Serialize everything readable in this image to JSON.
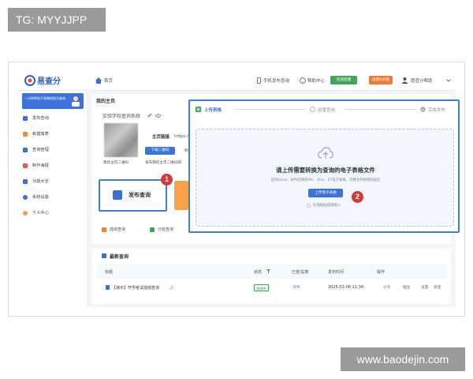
{
  "watermarks": {
    "top": "TG: MYYJJPP",
    "bottom": "www.baodejin.com"
  },
  "topbar": {
    "logo_text": "易查分",
    "logo_sub": "YICHAFEN.COM",
    "home_label": "首页",
    "phone_label": "手机发布查询",
    "help_label": "帮助中心",
    "service_label": "在线客服",
    "upgrade_label": "续费&升级",
    "user_label": "愿查分帮助"
  },
  "sidebar": {
    "banner_text": "一分钟将电子表格转换为查询",
    "items": [
      {
        "label": "发布查询",
        "color": "#3b6fd6"
      },
      {
        "label": "新建填表",
        "color": "#f08a3c"
      },
      {
        "label": "查询管理",
        "color": "#3b6fd6"
      },
      {
        "label": "制作海报",
        "color": "#e05a4e"
      },
      {
        "label": "功能大全",
        "color": "#3b6fd6"
      },
      {
        "label": "系统设置",
        "color": "#3b6fd6"
      },
      {
        "label": "个人中心",
        "color": "#f0a23c"
      }
    ]
  },
  "homepage": {
    "section_title": "我的主页",
    "system_name": "实验学校查询系统",
    "link_label": "主页链接",
    "link_value": "https:/",
    "download_qr": "下载二维码",
    "copy_label": "制",
    "my_qr_caption": "我的主页二维码",
    "publish_qr_caption": "发布我的主页二维码即"
  },
  "actions": {
    "publish_query": "发布查询",
    "step1_badge": "1"
  },
  "quick_links": {
    "score_query": "成绩查询",
    "class_query": "分班查询"
  },
  "latest": {
    "title": "最新查询",
    "columns": [
      "标题",
      "状态",
      "已查/总数",
      "发布时间",
      "操作"
    ],
    "rows": [
      {
        "title": "【演示】开学考试成绩查询",
        "status": "查询中",
        "count": "0/4",
        "time": "2025-02-06 11:34",
        "ops": [
          "分享",
          "推送",
          "设置",
          "管理"
        ]
      }
    ]
  },
  "upload_panel": {
    "steps": [
      "上传表格",
      "设置查询",
      "完成发布"
    ],
    "heading": "请上传需要转换为查询的电子表格文件",
    "support_text": "支持Excel、WPS创建的Xls、Xlsx、ET电子表格，可拜文件拖拽到此区",
    "upload_button": "上传电子表格",
    "online_hint": "在线粘贴成绩输入",
    "step2_badge": "2"
  },
  "colors": {
    "accent": "#3b73d8",
    "highlight_border": "#3f7fd1",
    "badge_red": "#d23a3a",
    "service_green": "#3fa65a",
    "upgrade_orange": "#f0793a"
  }
}
